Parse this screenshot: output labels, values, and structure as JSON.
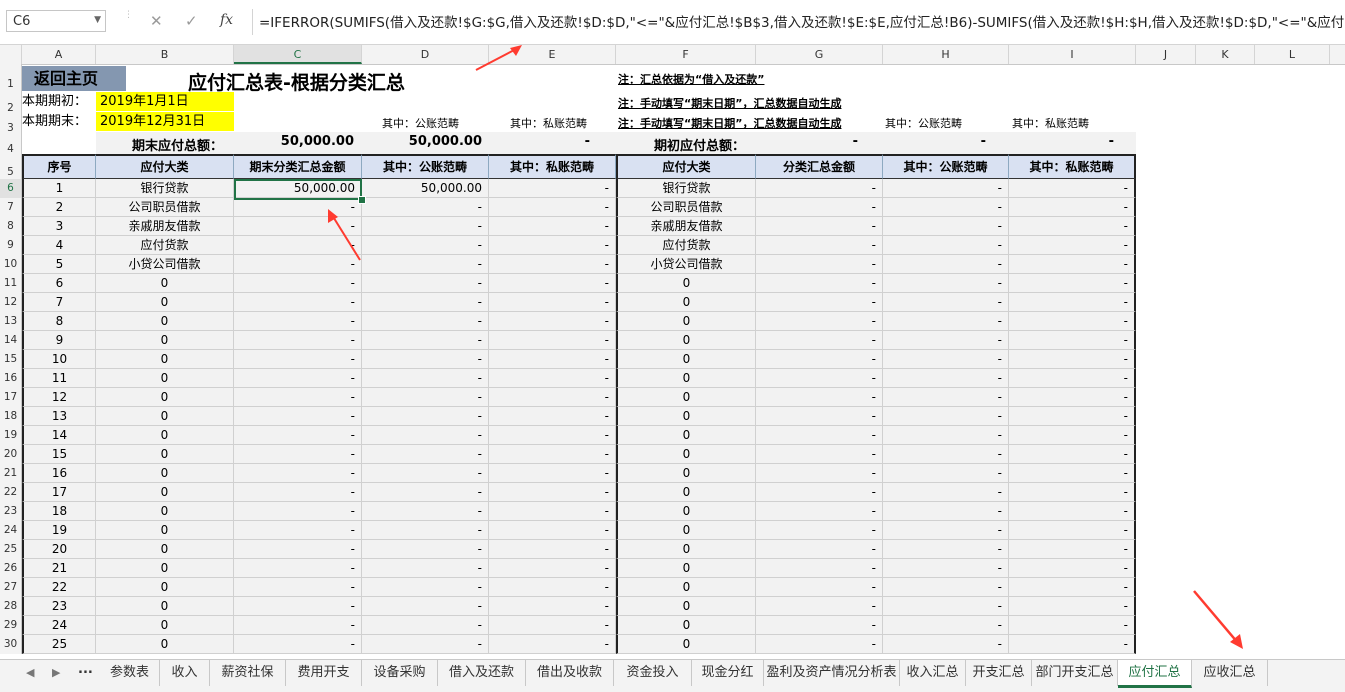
{
  "formula_bar": {
    "name_box": "C6",
    "cancel_icon": "✕",
    "enter_icon": "✓",
    "fx_icon": "fx",
    "formula": "=IFERROR(SUMIFS(借入及还款!$G:$G,借入及还款!$D:$D,\"<=\"&应付汇总!$B$3,借入及还款!$E:$E,应付汇总!B6)-SUMIFS(借入及还款!$H:$H,借入及还款!$D:$D,\"<=\"&应付"
  },
  "columns": [
    "A",
    "B",
    "C",
    "D",
    "E",
    "F",
    "G",
    "H",
    "I",
    "J",
    "K",
    "L",
    "M"
  ],
  "selected_column": "C",
  "rows": [
    "1",
    "2",
    "3",
    "4",
    "5",
    "6",
    "7",
    "8",
    "9",
    "10",
    "11",
    "12",
    "13",
    "14",
    "15",
    "16",
    "17",
    "18",
    "19",
    "20",
    "21",
    "22",
    "23",
    "24",
    "25",
    "26",
    "27",
    "28",
    "29",
    "30"
  ],
  "selected_row": "6",
  "sheet": {
    "home_button": "返回主页",
    "title": "应付汇总表-根据分类汇总",
    "period_start_label": "本期期初：",
    "period_start_value": "2019年1月1日",
    "period_end_label": "本期期末：",
    "period_end_value": "2019年12月31日",
    "note1": "注：汇总依据为“借入及还款”",
    "note2": "注：手动填写“期末日期”，汇总数据自动生成",
    "note3": "注：手动填写“期末日期”，汇总数据自动生成",
    "sub_public_label": "其中：公账范畴",
    "sub_private_label": "其中：私账范畴",
    "sub_public_label_right": "其中：公账范畴",
    "sub_private_label_right": "其中：私账范畴",
    "end_total_label": "期末应付总额：",
    "end_total_value": "50,000.00",
    "end_total_public": "50,000.00",
    "end_total_private": "-",
    "begin_total_label": "期初应付总额：",
    "begin_total_value": "-",
    "begin_total_public": "-",
    "begin_total_private": "-"
  },
  "table": {
    "headers": [
      "序号",
      "应付大类",
      "期末分类汇总金额",
      "其中：公账范畴",
      "其中：私账范畴",
      "应付大类",
      "分类汇总金额",
      "其中：公账范畴",
      "其中：私账范畴"
    ],
    "rows": [
      [
        "1",
        "银行贷款",
        "50,000.00",
        "50,000.00",
        "-",
        "银行贷款",
        "-",
        "-",
        "-"
      ],
      [
        "2",
        "公司职员借款",
        "-",
        "-",
        "-",
        "公司职员借款",
        "-",
        "-",
        "-"
      ],
      [
        "3",
        "亲戚朋友借款",
        "-",
        "-",
        "-",
        "亲戚朋友借款",
        "-",
        "-",
        "-"
      ],
      [
        "4",
        "应付货款",
        "-",
        "-",
        "-",
        "应付货款",
        "-",
        "-",
        "-"
      ],
      [
        "5",
        "小贷公司借款",
        "-",
        "-",
        "-",
        "小贷公司借款",
        "-",
        "-",
        "-"
      ],
      [
        "6",
        "0",
        "-",
        "-",
        "-",
        "0",
        "-",
        "-",
        "-"
      ],
      [
        "7",
        "0",
        "-",
        "-",
        "-",
        "0",
        "-",
        "-",
        "-"
      ],
      [
        "8",
        "0",
        "-",
        "-",
        "-",
        "0",
        "-",
        "-",
        "-"
      ],
      [
        "9",
        "0",
        "-",
        "-",
        "-",
        "0",
        "-",
        "-",
        "-"
      ],
      [
        "10",
        "0",
        "-",
        "-",
        "-",
        "0",
        "-",
        "-",
        "-"
      ],
      [
        "11",
        "0",
        "-",
        "-",
        "-",
        "0",
        "-",
        "-",
        "-"
      ],
      [
        "12",
        "0",
        "-",
        "-",
        "-",
        "0",
        "-",
        "-",
        "-"
      ],
      [
        "13",
        "0",
        "-",
        "-",
        "-",
        "0",
        "-",
        "-",
        "-"
      ],
      [
        "14",
        "0",
        "-",
        "-",
        "-",
        "0",
        "-",
        "-",
        "-"
      ],
      [
        "15",
        "0",
        "-",
        "-",
        "-",
        "0",
        "-",
        "-",
        "-"
      ],
      [
        "16",
        "0",
        "-",
        "-",
        "-",
        "0",
        "-",
        "-",
        "-"
      ],
      [
        "17",
        "0",
        "-",
        "-",
        "-",
        "0",
        "-",
        "-",
        "-"
      ],
      [
        "18",
        "0",
        "-",
        "-",
        "-",
        "0",
        "-",
        "-",
        "-"
      ],
      [
        "19",
        "0",
        "-",
        "-",
        "-",
        "0",
        "-",
        "-",
        "-"
      ],
      [
        "20",
        "0",
        "-",
        "-",
        "-",
        "0",
        "-",
        "-",
        "-"
      ],
      [
        "21",
        "0",
        "-",
        "-",
        "-",
        "0",
        "-",
        "-",
        "-"
      ],
      [
        "22",
        "0",
        "-",
        "-",
        "-",
        "0",
        "-",
        "-",
        "-"
      ],
      [
        "23",
        "0",
        "-",
        "-",
        "-",
        "0",
        "-",
        "-",
        "-"
      ],
      [
        "24",
        "0",
        "-",
        "-",
        "-",
        "0",
        "-",
        "-",
        "-"
      ],
      [
        "25",
        "0",
        "-",
        "-",
        "-",
        "0",
        "-",
        "-",
        "-"
      ]
    ]
  },
  "tabs": {
    "nav_prev": "◀",
    "nav_next": "▶",
    "nav_more": "...",
    "items": [
      "参数表",
      "收入",
      "薪资社保",
      "费用开支",
      "设备采购",
      "借入及还款",
      "借出及收款",
      "资金投入",
      "现金分红",
      "盈利及资产情况分析表",
      "收入汇总",
      "开支汇总",
      "部门开支汇总",
      "应付汇总",
      "应收汇总"
    ],
    "active": "应付汇总"
  },
  "colors": {
    "accent": "#217346",
    "header_fill": "#d9e1f2",
    "input_fill": "#ffff00",
    "home_button_fill": "#8497b0",
    "annotation_arrow": "#ff3b30"
  }
}
